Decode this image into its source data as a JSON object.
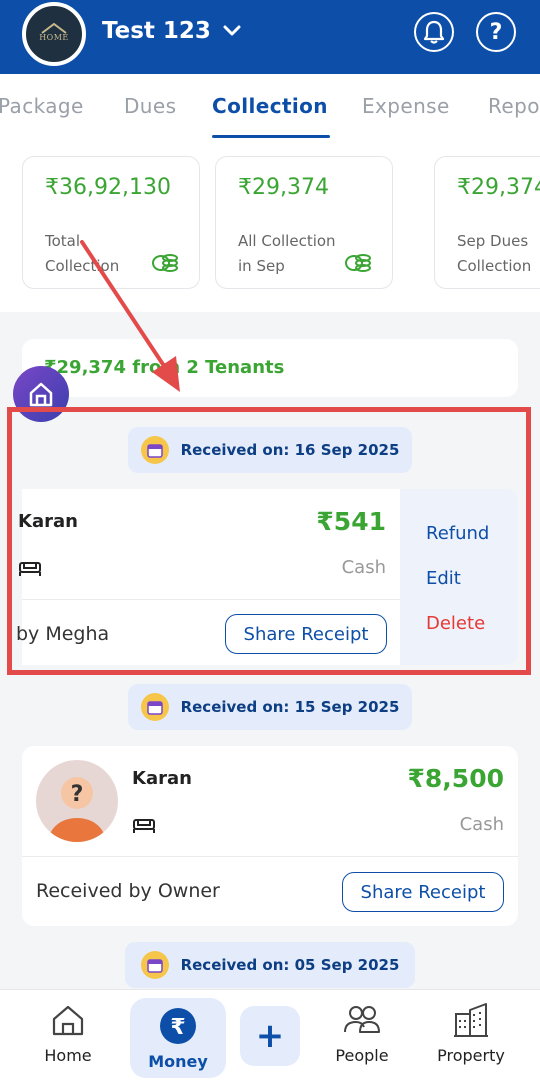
{
  "header": {
    "logo_text": "HOME",
    "org_name": "Test 123",
    "dropdown_icon": "chevron-down-icon",
    "bell_icon": "bell-icon",
    "help_label": "?"
  },
  "tabs": [
    {
      "label": "Package",
      "active": false
    },
    {
      "label": "Dues",
      "active": false
    },
    {
      "label": "Collection",
      "active": true
    },
    {
      "label": "Expense",
      "active": false
    },
    {
      "label": "Repo",
      "active": false
    }
  ],
  "stats": [
    {
      "value": "₹36,92,130",
      "label": "Total\nCollection"
    },
    {
      "value": "₹29,374",
      "label": "All Collection\nin Sep"
    },
    {
      "value": "₹29,374",
      "label": "Sep Dues\nCollection"
    }
  ],
  "summary": {
    "text": "₹29,374 from 2 Tenants"
  },
  "colors": {
    "primary": "#0d4fa8",
    "success": "#3ba534",
    "danger": "#e53935",
    "annotation": "#e34b4b"
  },
  "groups": [
    {
      "date_label": "Received on: 16 Sep 2025",
      "entry": {
        "tenant": "Karan",
        "amount": "₹541",
        "mode": "Cash",
        "received_by": "by Megha",
        "share_label": "Share Receipt",
        "actions": {
          "refund": "Refund",
          "edit": "Edit",
          "delete": "Delete"
        }
      }
    },
    {
      "date_label": "Received on: 15 Sep 2025",
      "entry": {
        "tenant": "Karan",
        "avatar_icon": "question-mark",
        "amount": "₹8,500",
        "mode": "Cash",
        "received_by": "Received by Owner",
        "share_label": "Share Receipt"
      }
    },
    {
      "date_label": "Received on: 05 Sep 2025"
    }
  ],
  "bottom_nav": [
    {
      "label": "Home",
      "icon": "home-icon",
      "active": false
    },
    {
      "label": "Money",
      "icon": "rupee-icon",
      "active": true
    },
    {
      "label": "+",
      "icon": "plus-icon",
      "active": false
    },
    {
      "label": "People",
      "icon": "people-icon",
      "active": false
    },
    {
      "label": "Property",
      "icon": "building-icon",
      "active": false
    }
  ]
}
